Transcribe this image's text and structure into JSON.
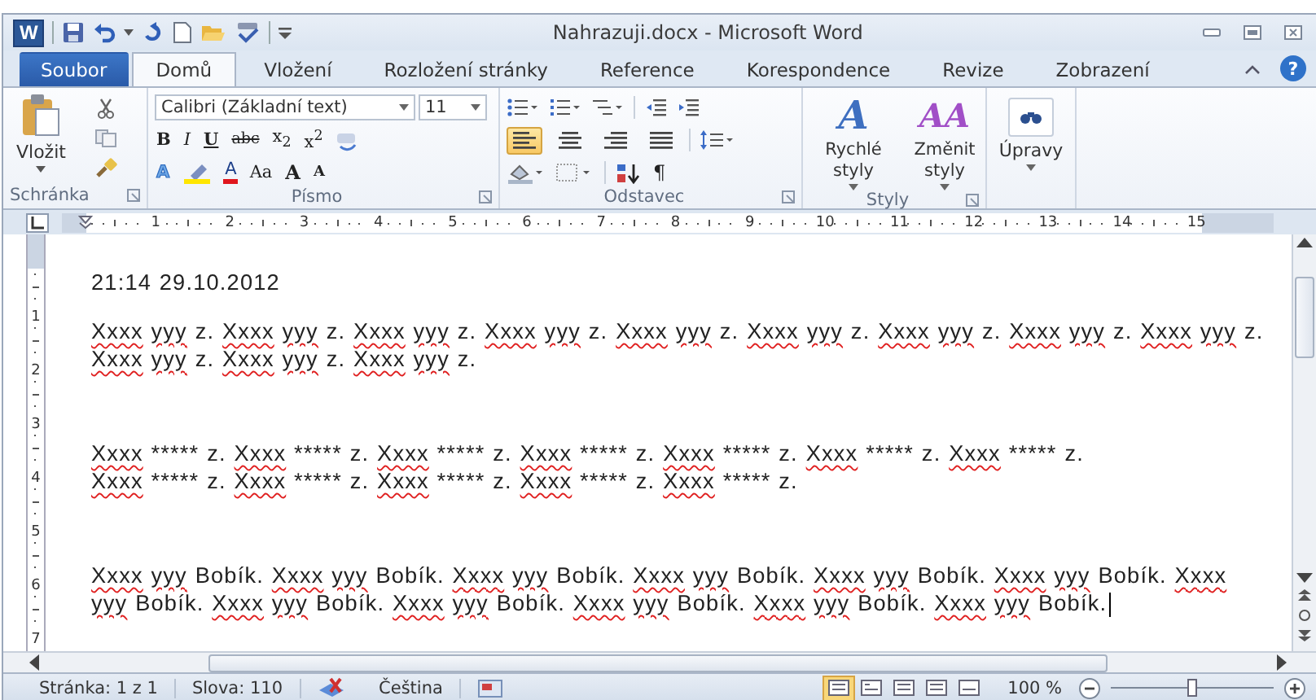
{
  "window": {
    "app_icon": "W",
    "title": "Nahrazuji.docx - Microsoft Word"
  },
  "tabs": [
    {
      "label": "Soubor",
      "kind": "file",
      "selected": false
    },
    {
      "label": "Domů",
      "kind": "normal",
      "selected": true
    },
    {
      "label": "Vložení",
      "kind": "normal",
      "selected": false
    },
    {
      "label": "Rozložení stránky",
      "kind": "normal",
      "selected": false
    },
    {
      "label": "Reference",
      "kind": "normal",
      "selected": false
    },
    {
      "label": "Korespondence",
      "kind": "normal",
      "selected": false
    },
    {
      "label": "Revize",
      "kind": "normal",
      "selected": false
    },
    {
      "label": "Zobrazení",
      "kind": "normal",
      "selected": false
    }
  ],
  "help": "?",
  "ribbon": {
    "clipboard": {
      "paste": "Vložit",
      "label": "Schránka"
    },
    "font": {
      "family": "Calibri (Základní text)",
      "size": "11",
      "styles": [
        "B",
        "I",
        "U",
        "abc",
        "x$_{2}$",
        "x$^{2}$"
      ],
      "effects": "A",
      "color_letter": "A",
      "case": "Aa",
      "grow": "A",
      "shrink": "A",
      "label": "Písmo"
    },
    "paragraph": {
      "alignments": [
        {
          "selected": true
        },
        {
          "selected": false
        },
        {
          "selected": false
        },
        {
          "selected": false
        }
      ],
      "pilcrow": "¶",
      "label": "Odstavec"
    },
    "styles": {
      "quick_glyph": "A",
      "quick": "Rychlé styly",
      "change_glyph": "AA",
      "change": "Změnit styly",
      "label": "Styly"
    },
    "editing": {
      "label": "Úpravy"
    }
  },
  "ruler": [
    "1",
    "2",
    "3",
    "4",
    "5",
    "6",
    "7",
    "8",
    "9",
    "10",
    "11",
    "12",
    "13",
    "14",
    "15"
  ],
  "vertical_ruler": [
    "1",
    "2",
    "3",
    "4",
    "5",
    "6",
    "7"
  ],
  "document": {
    "paragraphs": [
      {
        "lines": [
          [
            {
              "text": "21:14 29.10.2012",
              "misspelled": false
            }
          ]
        ]
      },
      {
        "lines": [
          [
            {
              "text": "Xxxx",
              "misspelled": true
            },
            {
              "text": "yyy",
              "misspelled": true
            },
            {
              "text": "z.",
              "misspelled": false
            },
            {
              "text": "Xxxx",
              "misspelled": true
            },
            {
              "text": "yyy",
              "misspelled": true
            },
            {
              "text": "z.",
              "misspelled": false
            },
            {
              "text": "Xxxx",
              "misspelled": true
            },
            {
              "text": "yyy",
              "misspelled": true
            },
            {
              "text": "z.",
              "misspelled": false
            },
            {
              "text": "Xxxx",
              "misspelled": true
            },
            {
              "text": "yyy",
              "misspelled": true
            },
            {
              "text": "z.",
              "misspelled": false
            },
            {
              "text": "Xxxx",
              "misspelled": true
            },
            {
              "text": "yyy",
              "misspelled": true
            },
            {
              "text": "z.",
              "misspelled": false
            },
            {
              "text": "Xxxx",
              "misspelled": true
            },
            {
              "text": "yyy",
              "misspelled": true
            },
            {
              "text": "z.",
              "misspelled": false
            },
            {
              "text": "Xxxx",
              "misspelled": true
            },
            {
              "text": "yyy",
              "misspelled": true
            },
            {
              "text": "z.",
              "misspelled": false
            },
            {
              "text": "Xxxx",
              "misspelled": true
            },
            {
              "text": "yyy",
              "misspelled": true
            },
            {
              "text": "z.",
              "misspelled": false
            },
            {
              "text": "Xxxx",
              "misspelled": true
            },
            {
              "text": "yyy",
              "misspelled": true
            },
            {
              "text": "z.",
              "misspelled": false
            }
          ],
          [
            {
              "text": "Xxxx",
              "misspelled": true
            },
            {
              "text": "yyy",
              "misspelled": true
            },
            {
              "text": "z.",
              "misspelled": false
            },
            {
              "text": "Xxxx",
              "misspelled": true
            },
            {
              "text": "yyy",
              "misspelled": true
            },
            {
              "text": "z.",
              "misspelled": false
            },
            {
              "text": "Xxxx",
              "misspelled": true
            },
            {
              "text": "yyy",
              "misspelled": true
            },
            {
              "text": "z.",
              "misspelled": false
            }
          ]
        ]
      },
      {
        "lines": [
          [
            {
              "text": "Xxxx",
              "misspelled": true
            },
            {
              "text": "*****",
              "misspelled": false
            },
            {
              "text": "z.",
              "misspelled": false
            },
            {
              "text": "Xxxx",
              "misspelled": true
            },
            {
              "text": "*****",
              "misspelled": false
            },
            {
              "text": "z.",
              "misspelled": false
            },
            {
              "text": "Xxxx",
              "misspelled": true
            },
            {
              "text": "*****",
              "misspelled": false
            },
            {
              "text": "z.",
              "misspelled": false
            },
            {
              "text": "Xxxx",
              "misspelled": true
            },
            {
              "text": "*****",
              "misspelled": false
            },
            {
              "text": "z.",
              "misspelled": false
            },
            {
              "text": "Xxxx",
              "misspelled": true
            },
            {
              "text": "*****",
              "misspelled": false
            },
            {
              "text": "z.",
              "misspelled": false
            },
            {
              "text": "Xxxx",
              "misspelled": true
            },
            {
              "text": "*****",
              "misspelled": false
            },
            {
              "text": "z.",
              "misspelled": false
            },
            {
              "text": "Xxxx",
              "misspelled": true
            },
            {
              "text": "*****",
              "misspelled": false
            },
            {
              "text": "z.",
              "misspelled": false
            }
          ],
          [
            {
              "text": "Xxxx",
              "misspelled": true
            },
            {
              "text": "*****",
              "misspelled": false
            },
            {
              "text": "z.",
              "misspelled": false
            },
            {
              "text": "Xxxx",
              "misspelled": true
            },
            {
              "text": "*****",
              "misspelled": false
            },
            {
              "text": "z.",
              "misspelled": false
            },
            {
              "text": "Xxxx",
              "misspelled": true
            },
            {
              "text": "*****",
              "misspelled": false
            },
            {
              "text": "z.",
              "misspelled": false
            },
            {
              "text": "Xxxx",
              "misspelled": true
            },
            {
              "text": "*****",
              "misspelled": false
            },
            {
              "text": "z.",
              "misspelled": false
            },
            {
              "text": "Xxxx",
              "misspelled": true
            },
            {
              "text": "*****",
              "misspelled": false
            },
            {
              "text": "z.",
              "misspelled": false
            }
          ]
        ]
      },
      {
        "lines": [
          [
            {
              "text": "Xxxx",
              "misspelled": true
            },
            {
              "text": "yyy",
              "misspelled": true
            },
            {
              "text": "Bobík.",
              "misspelled": false
            },
            {
              "text": "Xxxx",
              "misspelled": true
            },
            {
              "text": "yyy",
              "misspelled": true
            },
            {
              "text": "Bobík.",
              "misspelled": false
            },
            {
              "text": "Xxxx",
              "misspelled": true
            },
            {
              "text": "yyy",
              "misspelled": true
            },
            {
              "text": "Bobík.",
              "misspelled": false
            },
            {
              "text": "Xxxx",
              "misspelled": true
            },
            {
              "text": "yyy",
              "misspelled": true
            },
            {
              "text": "Bobík.",
              "misspelled": false
            },
            {
              "text": "Xxxx",
              "misspelled": true
            },
            {
              "text": "yyy",
              "misspelled": true
            },
            {
              "text": "Bobík.",
              "misspelled": false
            },
            {
              "text": "Xxxx",
              "misspelled": true
            },
            {
              "text": "yyy",
              "misspelled": true
            },
            {
              "text": "Bobík.",
              "misspelled": false
            },
            {
              "text": "Xxxx",
              "misspelled": true
            }
          ],
          [
            {
              "text": "yyy",
              "misspelled": true
            },
            {
              "text": "Bobík.",
              "misspelled": false
            },
            {
              "text": "Xxxx",
              "misspelled": true
            },
            {
              "text": "yyy",
              "misspelled": true
            },
            {
              "text": "Bobík.",
              "misspelled": false
            },
            {
              "text": "Xxxx",
              "misspelled": true
            },
            {
              "text": "yyy",
              "misspelled": true
            },
            {
              "text": "Bobík.",
              "misspelled": false
            },
            {
              "text": "Xxxx",
              "misspelled": true
            },
            {
              "text": "yyy",
              "misspelled": true
            },
            {
              "text": "Bobík.",
              "misspelled": false
            },
            {
              "text": "Xxxx",
              "misspelled": true
            },
            {
              "text": "yyy",
              "misspelled": true
            },
            {
              "text": "Bobík.",
              "misspelled": false
            },
            {
              "text": "Xxxx",
              "misspelled": true
            },
            {
              "text": "yyy",
              "misspelled": true
            },
            {
              "text": "Bobík.",
              "misspelled": false
            }
          ]
        ]
      }
    ]
  },
  "status_bar": {
    "page": "Stránka: 1 z 1",
    "words": "Slova: 110",
    "language": "Čeština",
    "views": [
      {
        "selected": true
      },
      {
        "selected": false
      },
      {
        "selected": false
      },
      {
        "selected": false
      },
      {
        "selected": false
      }
    ],
    "zoom": "100 %",
    "zoom_slider": {
      "level": 0.5
    }
  }
}
